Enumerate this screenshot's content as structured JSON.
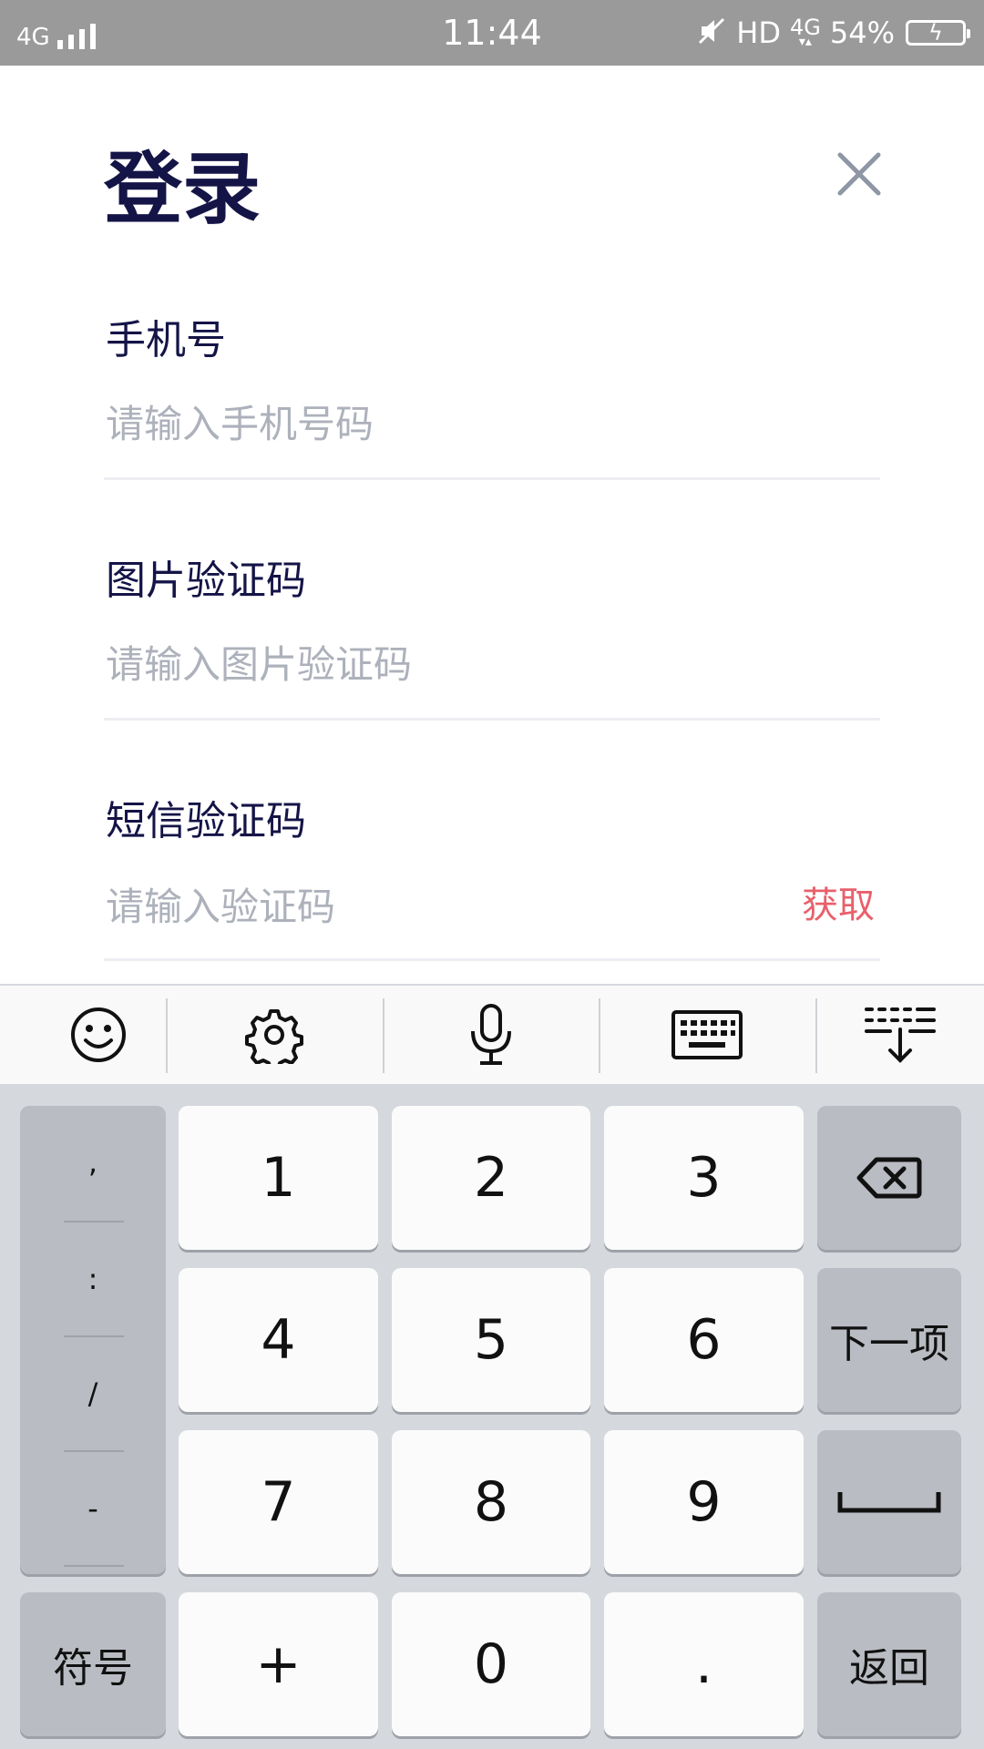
{
  "status_bar": {
    "network": "4G",
    "time": "11:44",
    "hd": "HD",
    "network_right": "4G",
    "battery": "54%",
    "icons": [
      "signal-icon",
      "mute-icon",
      "battery-charging-icon"
    ]
  },
  "login": {
    "title": "登录",
    "close_icon": "close-icon",
    "fields": [
      {
        "label": "手机号",
        "placeholder": "请输入手机号码"
      },
      {
        "label": "图片验证码",
        "placeholder": "请输入图片验证码"
      },
      {
        "label": "短信验证码",
        "placeholder": "请输入验证码",
        "action": "获取"
      }
    ]
  },
  "keyboard_toolbar": {
    "items": [
      "emoji-icon",
      "settings-icon",
      "microphone-icon",
      "keyboard-icon",
      "hide-keyboard-icon"
    ]
  },
  "keyboard": {
    "symbols": [
      ",",
      ":",
      "/",
      "-"
    ],
    "digits": [
      "1",
      "2",
      "3",
      "4",
      "5",
      "6",
      "7",
      "8",
      "9"
    ],
    "bottom": [
      "+",
      "0",
      "."
    ],
    "delete_icon": "backspace-icon",
    "next_label": "下一项",
    "space_icon": "space-icon",
    "symbols_label": "符号",
    "return_label": "返回"
  },
  "colors": {
    "status_bar_bg": "#9a9a9a",
    "title": "#141447",
    "placeholder": "#adb1bb",
    "accent_red": "#e8606b",
    "keyboard_bg": "#d5d8dd",
    "key_light": "#fbfbfb",
    "key_dark": "#b9bcc2"
  }
}
